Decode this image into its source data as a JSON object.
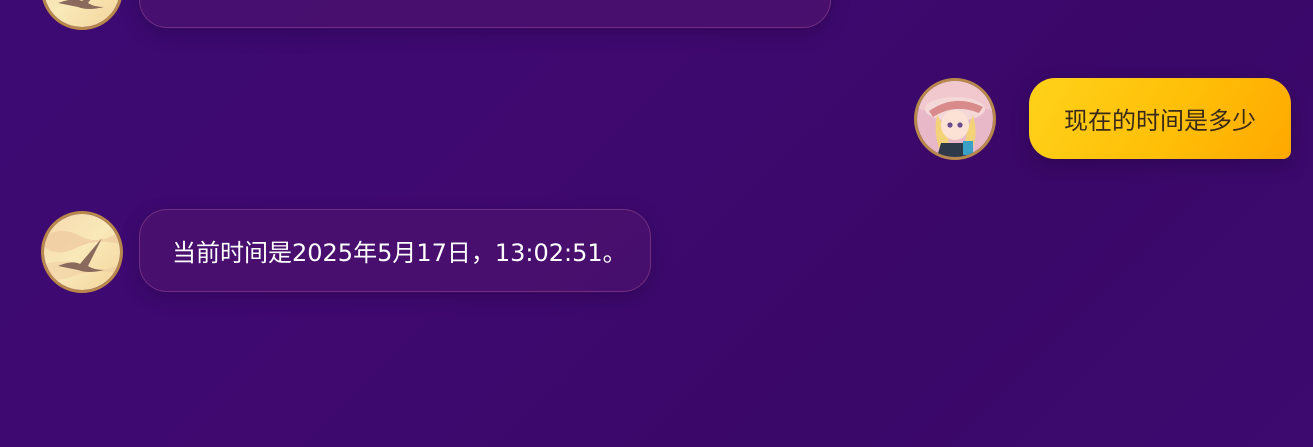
{
  "conversation": {
    "messages": [
      {
        "role": "assistant",
        "text": "",
        "avatar": "crane-avatar-icon"
      },
      {
        "role": "user",
        "text": "现在的时间是多少",
        "avatar": "anime-girl-avatar-icon"
      },
      {
        "role": "assistant",
        "text": "当前时间是2025年5月17日，13:02:51。",
        "avatar": "crane-avatar-icon"
      }
    ]
  },
  "colors": {
    "background": "#3c0a72",
    "bot_bubble": "#4e1470",
    "user_bubble": "#ffc20e",
    "avatar_border": "#b8874a"
  }
}
